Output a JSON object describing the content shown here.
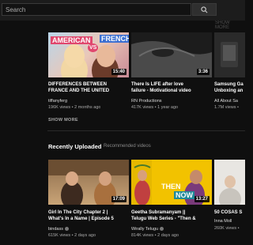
{
  "search": {
    "placeholder": "Search"
  },
  "top_section_label": "SHOW MORE",
  "top_row": [
    {
      "thumb_text_1": "AMERICAN",
      "thumb_text_2": "VS",
      "thumb_text_3": "FRENCH",
      "duration": "15:40",
      "title_1": "DIFFERENCES BETWEEN",
      "title_2": "FRANCE AND THE UNITED",
      "channel": "tiffanyferg",
      "meta": "196K views • 2 months ago"
    },
    {
      "duration": "3:36",
      "title_1": "There Is LIFE after love",
      "title_2": "failure - Motivational video",
      "channel": "RN Productions",
      "meta": "417K views • 1 year ago"
    },
    {
      "title_1": "Samsung Ga",
      "title_2": "Unboxing an",
      "channel": "All About Sa",
      "meta": "1.7M views •"
    }
  ],
  "show_more": "SHOW MORE",
  "section": {
    "title": "Recently Uploaded",
    "subtitle": "Recommended videos"
  },
  "bottom_row": [
    {
      "duration": "17:09",
      "title_1": "Girl In The City Chapter 2 |",
      "title_2": "What's In a Name | Episode 5",
      "channel": "bindass",
      "meta": "615K views • 2 days ago"
    },
    {
      "thumb_text_1": "THEN",
      "thumb_text_2": "NOW",
      "duration": "13:27",
      "title_1": "Geetha Subramanyam ||",
      "title_2": "Telugu Web Series - \"Then &",
      "channel": "Wirally Telugu",
      "meta": "814K views • 2 days ago"
    },
    {
      "title_1": "50 COSAS S",
      "channel": "Inna Moll",
      "meta": "260K views •"
    }
  ]
}
